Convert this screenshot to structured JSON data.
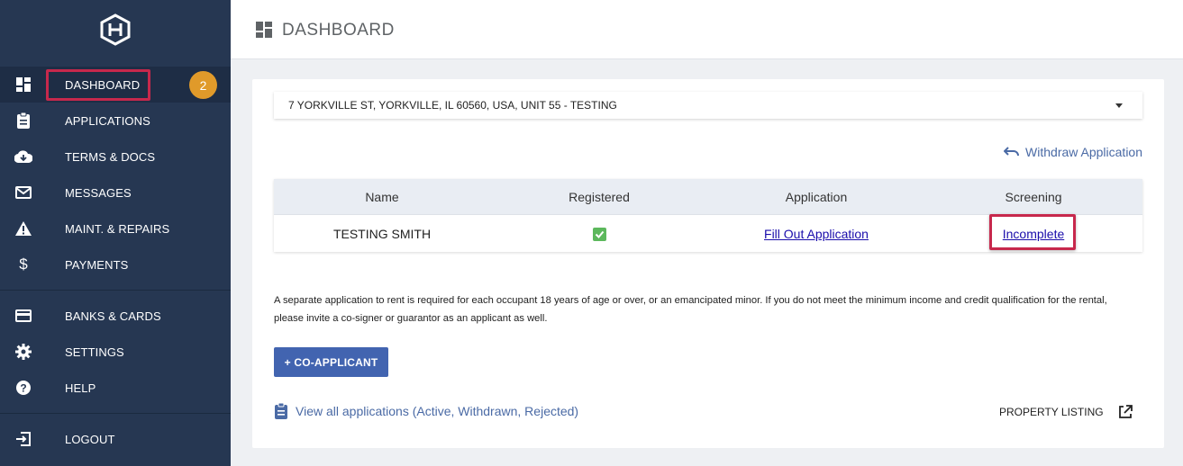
{
  "sidebar": {
    "items": [
      {
        "id": "dashboard",
        "label": "DASHBOARD",
        "icon": "dashboard-icon"
      },
      {
        "id": "applications",
        "label": "APPLICATIONS",
        "icon": "clipboard-icon"
      },
      {
        "id": "terms",
        "label": "TERMS & DOCS",
        "icon": "cloud-download-icon"
      },
      {
        "id": "messages",
        "label": "MESSAGES",
        "icon": "mail-icon"
      },
      {
        "id": "maint",
        "label": "MAINT. & REPAIRS",
        "icon": "warning-icon"
      },
      {
        "id": "payments",
        "label": "PAYMENTS",
        "icon": "dollar-icon"
      },
      {
        "id": "banks",
        "label": "BANKS & CARDS",
        "icon": "credit-card-icon"
      },
      {
        "id": "settings",
        "label": "SETTINGS",
        "icon": "gear-icon"
      },
      {
        "id": "help",
        "label": "HELP",
        "icon": "help-icon"
      },
      {
        "id": "logout",
        "label": "LOGOUT",
        "icon": "logout-icon"
      }
    ],
    "badge": "2"
  },
  "header": {
    "title": "DASHBOARD"
  },
  "property_select": {
    "value": "7 YORKVILLE ST, YORKVILLE, IL 60560, USA, UNIT 55 - TESTING"
  },
  "applicants": {
    "withdraw_label": "Withdraw Application",
    "columns": [
      "Name",
      "Registered",
      "Application",
      "Screening"
    ],
    "rows": [
      {
        "name": "TESTING SMITH",
        "registered": true,
        "application": "Fill Out Application",
        "screening": "Incomplete"
      }
    ]
  },
  "note": "A separate application to rent is required for each occupant 18 years of age or over, or an emancipated minor. If you do not meet the minimum income and credit qualification for the rental, please invite a co-signer or guarantor as an applicant as well.",
  "coapplicant_button": "+ CO-APPLICANT",
  "view_all_link": "View all applications (Active, Withdrawn, Rejected)",
  "property_listing_link": "PROPERTY LISTING",
  "colors": {
    "sidebar": "#263752",
    "accent": "#4264b0",
    "highlight": "#c7284c",
    "badge": "#e09a2a"
  }
}
